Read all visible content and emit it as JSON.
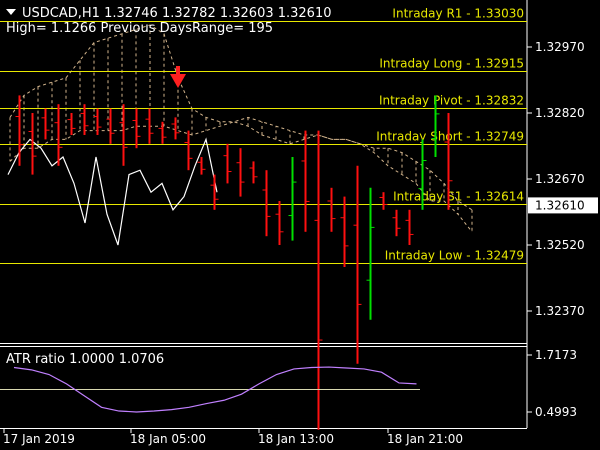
{
  "header": {
    "symbol_line": "USDCAD,H1  1.32746 1.32782 1.32603 1.32610",
    "range_line": "High= 1.1266 Previous DaysRange= 195"
  },
  "price_axis": {
    "ticks": [
      {
        "value": 1.3297,
        "label": "1.32970"
      },
      {
        "value": 1.3282,
        "label": "1.32820"
      },
      {
        "value": 1.3267,
        "label": "1.32670"
      },
      {
        "value": 1.3252,
        "label": "1.32520"
      },
      {
        "value": 1.3237,
        "label": "1.32370"
      }
    ],
    "current_price": {
      "value": 1.3261,
      "label": "1.32610"
    }
  },
  "levels": [
    {
      "name": "Intraday R1",
      "text": "Intraday R1 - 1.33030",
      "value": 1.3303
    },
    {
      "name": "Intraday Long",
      "text": "Intraday Long - 1.32915",
      "value": 1.32915
    },
    {
      "name": "Intraday Pivot",
      "text": "Intraday Pivot - 1.32832",
      "value": 1.32832
    },
    {
      "name": "Intraday Short",
      "text": "Intraday Short - 1.32749",
      "value": 1.32749
    },
    {
      "name": "Intraday S1",
      "text": "Intraday S1 - 1.32614",
      "value": 1.32614
    },
    {
      "name": "Intraday Low",
      "text": "Intraday Low - 1.32479",
      "value": 1.32479
    }
  ],
  "atr_panel": {
    "label": "ATR ratio 1.0000 1.0706",
    "ticks": [
      {
        "value": 1.7173,
        "label": "1.7173"
      },
      {
        "value": 0.4993,
        "label": "0.4993"
      }
    ],
    "level_line": 1.0,
    "series": [
      1.45,
      1.4,
      1.3,
      1.1,
      0.85,
      0.6,
      0.52,
      0.5,
      0.52,
      0.55,
      0.6,
      0.68,
      0.75,
      0.88,
      1.1,
      1.3,
      1.42,
      1.45,
      1.46,
      1.44,
      1.42,
      1.35,
      1.12,
      1.1
    ]
  },
  "time_axis": {
    "labels": [
      "17 Jan 2019",
      "18 Jan 05:00",
      "18 Jan 13:00",
      "18 Jan 21:00"
    ]
  },
  "colors": {
    "up": "#00e000",
    "down": "#ff1010",
    "level": "#e8e800",
    "axis": "#ffffff",
    "atr": "#c080ff",
    "band": "#d2b48c",
    "arrow": "#ff2020"
  },
  "chart_data": {
    "type": "candlestick",
    "candles": [
      {
        "h": 1.3286,
        "l": 1.327,
        "d": "down"
      },
      {
        "h": 1.3282,
        "l": 1.3268,
        "d": "down"
      },
      {
        "h": 1.3283,
        "l": 1.3276,
        "d": "down"
      },
      {
        "h": 1.3284,
        "l": 1.327,
        "d": "down"
      },
      {
        "h": 1.3282,
        "l": 1.3277,
        "d": "down"
      },
      {
        "h": 1.3284,
        "l": 1.3277,
        "d": "down"
      },
      {
        "h": 1.3283,
        "l": 1.3277,
        "d": "down"
      },
      {
        "h": 1.3283,
        "l": 1.3275,
        "d": "down"
      },
      {
        "h": 1.3284,
        "l": 1.327,
        "d": "down"
      },
      {
        "h": 1.3283,
        "l": 1.3274,
        "d": "down"
      },
      {
        "h": 1.3283,
        "l": 1.3275,
        "d": "down"
      },
      {
        "h": 1.328,
        "l": 1.3275,
        "d": "down"
      },
      {
        "h": 1.3281,
        "l": 1.3276,
        "d": "down"
      },
      {
        "h": 1.3278,
        "l": 1.3269,
        "d": "down"
      },
      {
        "h": 1.3272,
        "l": 1.3268,
        "d": "down"
      },
      {
        "h": 1.3268,
        "l": 1.326,
        "d": "down"
      },
      {
        "h": 1.3275,
        "l": 1.3266,
        "d": "down"
      },
      {
        "h": 1.3274,
        "l": 1.3263,
        "d": "down"
      },
      {
        "h": 1.3271,
        "l": 1.3266,
        "d": "down"
      },
      {
        "h": 1.3269,
        "l": 1.3254,
        "d": "down"
      },
      {
        "h": 1.3262,
        "l": 1.3252,
        "d": "down"
      },
      {
        "h": 1.3272,
        "l": 1.3253,
        "d": "up"
      },
      {
        "h": 1.3278,
        "l": 1.3255,
        "d": "down"
      },
      {
        "h": 1.3278,
        "l": 1.321,
        "d": "down"
      },
      {
        "h": 1.3265,
        "l": 1.3255,
        "d": "down"
      },
      {
        "h": 1.3263,
        "l": 1.3247,
        "d": "down"
      },
      {
        "h": 1.327,
        "l": 1.3225,
        "d": "down"
      },
      {
        "h": 1.3265,
        "l": 1.3235,
        "d": "up"
      },
      {
        "h": 1.3264,
        "l": 1.326,
        "d": "down"
      },
      {
        "h": 1.326,
        "l": 1.3254,
        "d": "down"
      },
      {
        "h": 1.326,
        "l": 1.3252,
        "d": "down"
      },
      {
        "h": 1.3276,
        "l": 1.326,
        "d": "up"
      },
      {
        "h": 1.3286,
        "l": 1.3272,
        "d": "up"
      },
      {
        "h": 1.3282,
        "l": 1.326,
        "d": "down"
      }
    ],
    "close_line": [
      1.3268,
      1.3273,
      1.3276,
      1.3274,
      1.327,
      1.3272,
      1.3266,
      1.3257,
      1.3272,
      1.3259,
      1.3252,
      1.3268,
      1.3269,
      1.3264,
      1.3266,
      1.326,
      1.3263,
      1.327,
      1.3276,
      1.3264
    ],
    "band_upper": [
      1.3281,
      1.3286,
      1.3288,
      1.3289,
      1.329,
      1.3294,
      1.3298,
      1.3299,
      1.33,
      1.3301,
      1.3302,
      1.33,
      1.329,
      1.3283,
      1.3281,
      1.328,
      1.328,
      1.3279,
      1.3277,
      1.3276,
      1.3275,
      1.3276,
      1.3277,
      1.3276,
      1.3276,
      1.3275,
      1.3274,
      1.3274,
      1.3273,
      1.3271,
      1.3269,
      1.3266,
      1.3262,
      1.326
    ],
    "band_lower": [
      1.3271,
      1.3274,
      1.3274,
      1.3276,
      1.3276,
      1.3278,
      1.3278,
      1.3278,
      1.3278,
      1.3279,
      1.3279,
      1.3279,
      1.3278,
      1.3277,
      1.3278,
      1.3279,
      1.328,
      1.3281,
      1.328,
      1.3279,
      1.3278,
      1.3277,
      1.3277,
      1.3276,
      1.3276,
      1.3275,
      1.3273,
      1.327,
      1.3268,
      1.3266,
      1.3262,
      1.3262,
      1.3259,
      1.3255
    ]
  }
}
